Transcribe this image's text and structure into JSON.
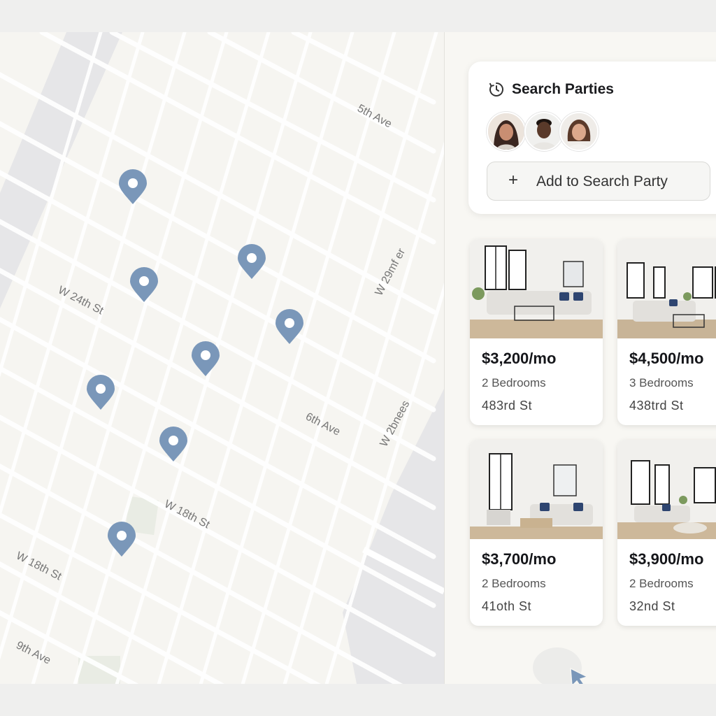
{
  "map": {
    "street_labels": [
      "5th Ave",
      "W 24th St",
      "W 29mf er",
      "6th Ave",
      "W 2bnees",
      "W 18th St",
      "W 18th St",
      "9th Ave"
    ],
    "pin_icon": "map-pin-icon",
    "pin_color": "#7a97b9"
  },
  "search_party": {
    "title": "Search Parties",
    "icon": "clock-icon",
    "members": [
      "avatar-1",
      "avatar-2",
      "avatar-3"
    ],
    "add_label": "Add to Search Party",
    "add_icon": "plus-icon"
  },
  "listings": [
    {
      "price": "$3,200/mo",
      "beds": "2 Bedrooms",
      "address": "483rd St"
    },
    {
      "price": "$4,500/mo",
      "beds": "3 Bedrooms",
      "address": "438trd St"
    },
    {
      "price": "$3,700/mo",
      "beds": "2 Bedrooms",
      "address": "41oth St"
    },
    {
      "price": "$3,900/mo",
      "beds": "2 Bedrooms",
      "address": "32nd St"
    }
  ],
  "colors": {
    "accent": "#7a97b9",
    "map_bg": "#f6f5f1",
    "water": "#e4e4e6"
  }
}
